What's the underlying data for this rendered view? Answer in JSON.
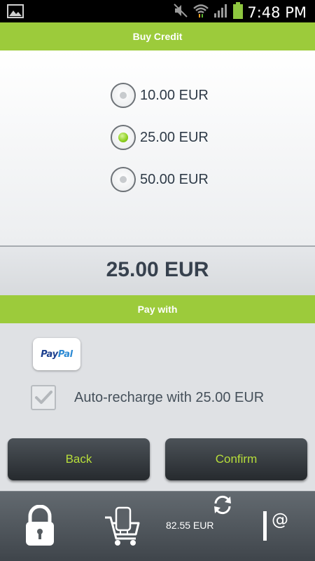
{
  "status_bar": {
    "time": "7:48 PM"
  },
  "header": {
    "title": "Buy Credit"
  },
  "amount_options": [
    {
      "label": "10.00 EUR",
      "selected": false
    },
    {
      "label": "25.00 EUR",
      "selected": true
    },
    {
      "label": "50.00 EUR",
      "selected": false
    }
  ],
  "total": "25.00 EUR",
  "pay_section": {
    "title": "Pay with",
    "method_logo_text": "PayPal"
  },
  "auto_recharge": {
    "label": "Auto-recharge with 25.00 EUR",
    "checked": true
  },
  "buttons": {
    "back": "Back",
    "confirm": "Confirm"
  },
  "bottom_nav": {
    "balance": "82.55 EUR"
  },
  "colors": {
    "accent": "#9ccb3b",
    "button_text": "#b7de3a"
  }
}
